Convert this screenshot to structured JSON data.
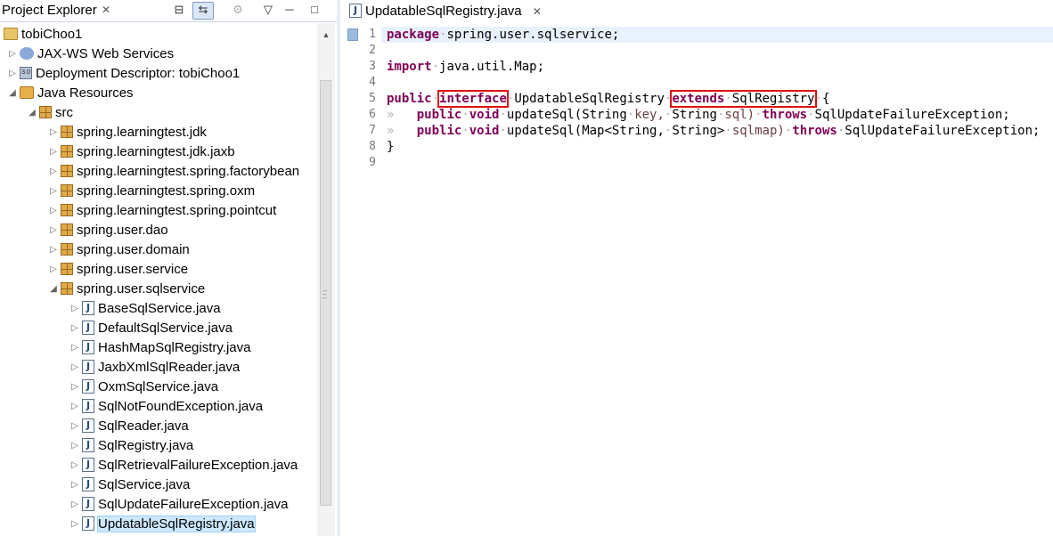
{
  "explorer": {
    "title": "Project Explorer",
    "close_icon": "✕",
    "toolbar": {
      "collapse_icon": "⊟",
      "link_icon": "⇆",
      "filter_icon": "⚙",
      "menu_icon": "▽",
      "minimize_icon": "─",
      "maximize_icon": "□"
    },
    "tree": [
      {
        "label": "tobiChoo1",
        "icon": "project-icon",
        "twisty": ""
      },
      {
        "label": "JAX-WS Web Services",
        "icon": "webservice-icon",
        "twisty": "▷"
      },
      {
        "label": "Deployment Descriptor: tobiChoo1",
        "icon": "descriptor-icon",
        "twisty": "▷"
      },
      {
        "label": "Java Resources",
        "icon": "java-resources-icon",
        "twisty": "◢"
      },
      {
        "label": "src",
        "icon": "source-folder-icon",
        "twisty": "◢"
      },
      {
        "label": "spring.learningtest.jdk",
        "icon": "package-icon",
        "twisty": "▷"
      },
      {
        "label": "spring.learningtest.jdk.jaxb",
        "icon": "package-icon",
        "twisty": "▷"
      },
      {
        "label": "spring.learningtest.spring.factorybean",
        "icon": "package-icon",
        "twisty": "▷"
      },
      {
        "label": "spring.learningtest.spring.oxm",
        "icon": "package-icon",
        "twisty": "▷"
      },
      {
        "label": "spring.learningtest.spring.pointcut",
        "icon": "package-icon",
        "twisty": "▷"
      },
      {
        "label": "spring.user.dao",
        "icon": "package-icon",
        "twisty": "▷"
      },
      {
        "label": "spring.user.domain",
        "icon": "package-icon",
        "twisty": "▷"
      },
      {
        "label": "spring.user.service",
        "icon": "package-icon",
        "twisty": "▷"
      },
      {
        "label": "spring.user.sqlservice",
        "icon": "package-icon",
        "twisty": "◢"
      },
      {
        "label": "BaseSqlService.java",
        "icon": "java-file-icon",
        "twisty": "▷"
      },
      {
        "label": "DefaultSqlService.java",
        "icon": "java-file-icon",
        "twisty": "▷"
      },
      {
        "label": "HashMapSqlRegistry.java",
        "icon": "java-file-icon",
        "twisty": "▷"
      },
      {
        "label": "JaxbXmlSqlReader.java",
        "icon": "java-file-icon",
        "twisty": "▷"
      },
      {
        "label": "OxmSqlService.java",
        "icon": "java-file-icon",
        "twisty": "▷"
      },
      {
        "label": "SqlNotFoundException.java",
        "icon": "java-file-icon",
        "twisty": "▷"
      },
      {
        "label": "SqlReader.java",
        "icon": "java-file-icon",
        "twisty": "▷"
      },
      {
        "label": "SqlRegistry.java",
        "icon": "java-file-icon",
        "twisty": "▷"
      },
      {
        "label": "SqlRetrievalFailureException.java",
        "icon": "java-file-icon",
        "twisty": "▷"
      },
      {
        "label": "SqlService.java",
        "icon": "java-file-icon",
        "twisty": "▷"
      },
      {
        "label": "SqlUpdateFailureException.java",
        "icon": "java-file-icon",
        "twisty": "▷"
      },
      {
        "label": "UpdatableSqlRegistry.java",
        "icon": "java-file-icon",
        "twisty": "▷",
        "selected": true
      }
    ]
  },
  "editor": {
    "tab_label": "UpdatableSqlRegistry.java",
    "tab_icon": "J",
    "tab_close_icon": "✕",
    "line_numbers": [
      "1",
      "2",
      "3",
      "4",
      "5",
      "6",
      "7",
      "8",
      "9"
    ],
    "code": {
      "l1_kw": "package",
      "l1_rest": "spring.user.sqlservice;",
      "l3_kw": "import",
      "l3_rest": "java.util.Map;",
      "l5_kw1": "public",
      "l5_kw2": "interface",
      "l5_name": "UpdatableSqlRegistry",
      "l5_kw3": "extends",
      "l5_super": "SqlRegistry",
      "l5_brace": "{",
      "l6_tab": "»",
      "l6_kw1": "public",
      "l6_kw2": "void",
      "l6_a": "updateSql(String",
      "l6_p1": "key,",
      "l6_b": "String",
      "l6_p2": "sql)",
      "l6_kw3": "throws",
      "l6_c": "SqlUpdateFailureException;",
      "l7_tab": "»",
      "l7_kw1": "public",
      "l7_kw2": "void",
      "l7_a": "updateSql(Map<String,",
      "l7_b": "String>",
      "l7_p1": "sqlmap)",
      "l7_kw3": "throws",
      "l7_c": "SqlUpdateFailureException;",
      "l8": "}"
    }
  }
}
